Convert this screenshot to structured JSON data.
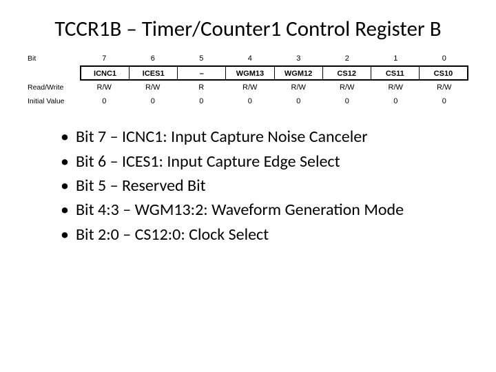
{
  "title": "TCCR1B – Timer/Counter1 Control Register B",
  "diagram": {
    "bit_label": "Bit",
    "rw_label": "Read/Write",
    "init_label": "Initial Value",
    "bit_numbers": [
      "7",
      "6",
      "5",
      "4",
      "3",
      "2",
      "1",
      "0"
    ],
    "bit_names": [
      "ICNC1",
      "ICES1",
      "–",
      "WGM13",
      "WGM12",
      "CS12",
      "CS11",
      "CS10"
    ],
    "rw": [
      "R/W",
      "R/W",
      "R",
      "R/W",
      "R/W",
      "R/W",
      "R/W",
      "R/W"
    ],
    "initial": [
      "0",
      "0",
      "0",
      "0",
      "0",
      "0",
      "0",
      "0"
    ]
  },
  "bullets": [
    "Bit 7 – ICNC1: Input Capture Noise Canceler",
    "Bit 6 – ICES1: Input Capture Edge Select",
    "Bit 5 – Reserved Bit",
    "Bit 4:3 – WGM13:2: Waveform Generation Mode",
    "Bit 2:0 – CS12:0: Clock Select"
  ]
}
